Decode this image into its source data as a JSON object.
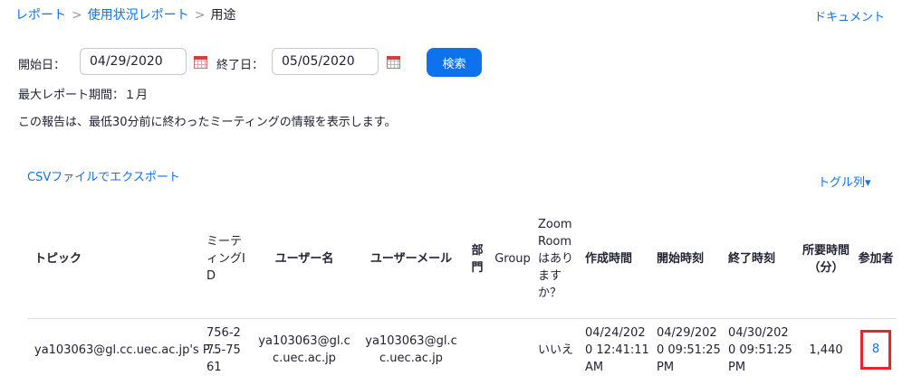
{
  "breadcrumb": {
    "reports": "レポート",
    "usage_reports": "使用状況レポート",
    "current": "用途",
    "sep": ">"
  },
  "doc_link": "ドキュメント",
  "filters": {
    "start_label": "開始日：",
    "start_value": "04/29/2020",
    "end_label": "終了日：",
    "end_value": "05/05/2020",
    "search_label": "検索"
  },
  "max_period": "最大レポート期間：１月",
  "info_text": "この報告は、最低30分前に終わったミーティングの情報を表示します。",
  "export_label": "CSVファイルでエクスポート",
  "toggle_label": "トグル列▾",
  "table": {
    "headers": {
      "topic": "トピック",
      "meeting_id": "ミーティングID",
      "user_name": "ユーザー名",
      "user_email": "ユーザーメール",
      "department": "部門",
      "group": "Group",
      "zoom_room": "Zoom Roomはありますか？",
      "created": "作成時間",
      "start": "開始時刻",
      "end": "終了時刻",
      "duration": "所要時間（分）",
      "participants": "参加者"
    },
    "rows": [
      {
        "topic": "ya103063@gl.cc.uec.ac.jp's P...",
        "meeting_id": "756-275-7561",
        "user_name": "ya103063@gl.cc.uec.ac.jp",
        "user_email": "ya103063@gl.cc.uec.ac.jp",
        "department": "",
        "group": "",
        "zoom_room": "いいえ",
        "created": "04/24/2020 12:41:11 AM",
        "start": "04/29/2020 09:51:25 PM",
        "end": "04/30/2020 09:51:25 PM",
        "duration": "1,440",
        "participants": "8"
      }
    ]
  },
  "colors": {
    "accent": "#0e72ed",
    "highlight": "#e5262e"
  },
  "icons": {
    "calendar": "calendar-icon"
  }
}
